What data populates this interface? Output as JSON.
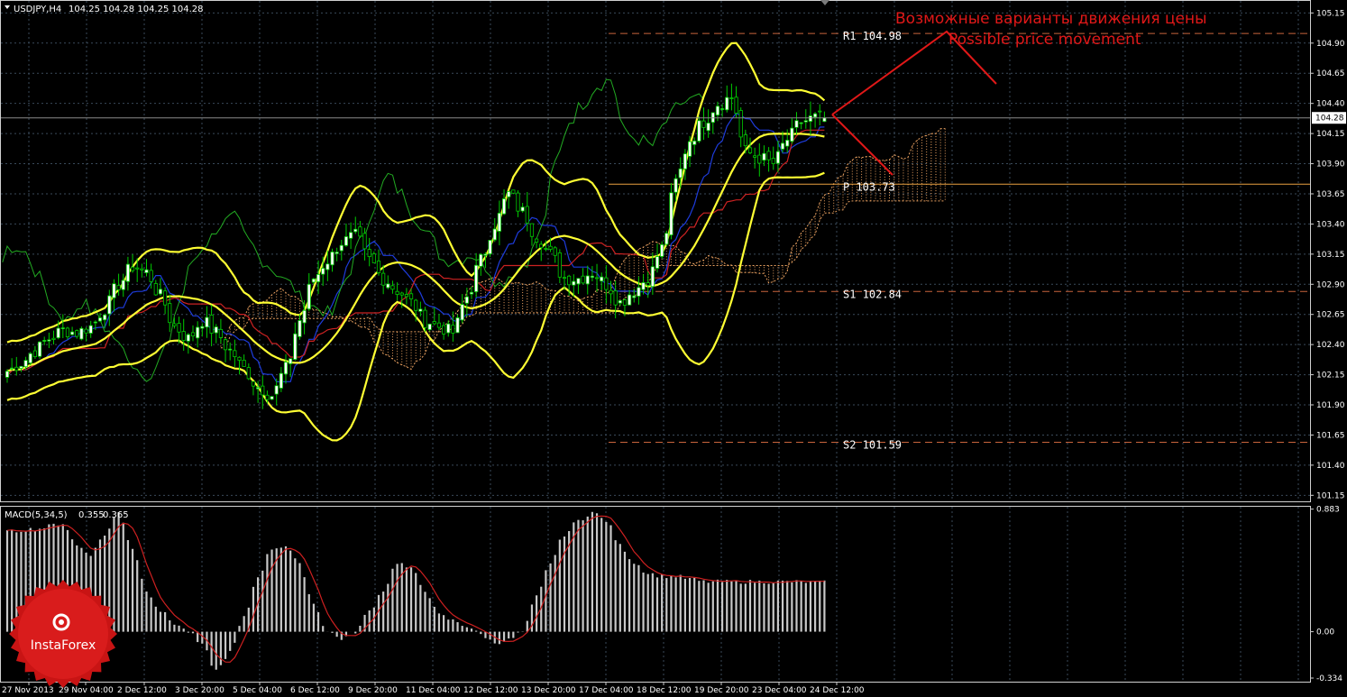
{
  "header": {
    "symbol_timeframe": "USDJPY,H4",
    "ohlc": "104.25 104.28 104.25 104.28"
  },
  "annotations": {
    "ru": "Возможные варианты движения цены",
    "en": "Possible price movement"
  },
  "pivot_levels": [
    {
      "label": "R1",
      "value": 104.98,
      "color": "#c8643c",
      "style": "dashed"
    },
    {
      "label": "P",
      "value": 103.73,
      "color": "#e8a040",
      "style": "solid"
    },
    {
      "label": "S1",
      "value": 102.84,
      "color": "#c8643c",
      "style": "dashed"
    },
    {
      "label": "S2",
      "value": 101.59,
      "color": "#c8643c",
      "style": "dashed"
    }
  ],
  "logo": {
    "text": "InstaForex"
  },
  "chart_data": {
    "type": "candlestick",
    "price_axis_ticks": [
      "105.15",
      "104.90",
      "104.65",
      "104.40",
      "104.15",
      "103.90",
      "103.65",
      "103.40",
      "103.15",
      "102.90",
      "102.65",
      "102.40",
      "102.15",
      "101.90",
      "101.65",
      "101.40",
      "101.15"
    ],
    "price_ylim": [
      101.1,
      105.25
    ],
    "current_price": "104.28",
    "x_tick_labels": [
      "27 Nov 2013",
      "29 Nov 04:00",
      "2 Dec 12:00",
      "3 Dec 20:00",
      "5 Dec 04:00",
      "6 Dec 12:00",
      "9 Dec 20:00",
      "11 Dec 04:00",
      "12 Dec 12:00",
      "13 Dec 20:00",
      "17 Dec 04:00",
      "18 Dec 12:00",
      "19 Dec 20:00",
      "23 Dec 04:00",
      "24 Dec 12:00"
    ],
    "macd": {
      "label": "MACD(5,34,5)",
      "main": "0.355",
      "signal": "0.365",
      "axis_ticks": [
        "0.883",
        "0.00",
        "-0.334"
      ],
      "ylim": [
        -0.36,
        0.9
      ]
    },
    "candle_key_points": [
      [
        0,
        102.18
      ],
      [
        3,
        102.25
      ],
      [
        6,
        102.35
      ],
      [
        9,
        102.45
      ],
      [
        12,
        102.52
      ],
      [
        15,
        102.5
      ],
      [
        18,
        102.55
      ],
      [
        21,
        102.7
      ],
      [
        24,
        102.9
      ],
      [
        27,
        103.05
      ],
      [
        30,
        103.0
      ],
      [
        33,
        102.8
      ],
      [
        36,
        102.55
      ],
      [
        39,
        102.45
      ],
      [
        42,
        102.6
      ],
      [
        45,
        102.5
      ],
      [
        48,
        102.35
      ],
      [
        51,
        102.2
      ],
      [
        54,
        102.05
      ],
      [
        57,
        101.98
      ],
      [
        60,
        102.2
      ],
      [
        63,
        102.6
      ],
      [
        66,
        102.95
      ],
      [
        69,
        103.1
      ],
      [
        72,
        103.25
      ],
      [
        75,
        103.3
      ],
      [
        78,
        103.1
      ],
      [
        81,
        102.95
      ],
      [
        84,
        102.85
      ],
      [
        87,
        102.75
      ],
      [
        90,
        102.6
      ],
      [
        93,
        102.55
      ],
      [
        96,
        102.5
      ],
      [
        99,
        102.8
      ],
      [
        102,
        103.1
      ],
      [
        105,
        103.4
      ],
      [
        108,
        103.65
      ],
      [
        111,
        103.5
      ],
      [
        114,
        103.3
      ],
      [
        117,
        103.15
      ],
      [
        120,
        102.95
      ],
      [
        123,
        102.95
      ],
      [
        126,
        103.0
      ],
      [
        129,
        102.9
      ],
      [
        132,
        102.75
      ],
      [
        135,
        102.85
      ],
      [
        138,
        102.95
      ],
      [
        141,
        103.2
      ],
      [
        144,
        103.75
      ],
      [
        147,
        104.1
      ],
      [
        150,
        104.25
      ],
      [
        153,
        104.4
      ],
      [
        156,
        104.45
      ],
      [
        159,
        104.0
      ],
      [
        162,
        103.95
      ],
      [
        165,
        103.9
      ],
      [
        168,
        104.1
      ],
      [
        171,
        104.25
      ],
      [
        174,
        104.28
      ],
      [
        176,
        104.28
      ]
    ],
    "macd_key_points": [
      [
        0,
        0.72
      ],
      [
        6,
        0.74
      ],
      [
        12,
        0.78
      ],
      [
        15,
        0.62
      ],
      [
        18,
        0.56
      ],
      [
        21,
        0.7
      ],
      [
        24,
        0.86
      ],
      [
        27,
        0.6
      ],
      [
        30,
        0.3
      ],
      [
        33,
        0.15
      ],
      [
        36,
        0.06
      ],
      [
        39,
        0.0
      ],
      [
        42,
        -0.1
      ],
      [
        45,
        -0.28
      ],
      [
        48,
        -0.15
      ],
      [
        51,
        0.1
      ],
      [
        54,
        0.4
      ],
      [
        57,
        0.6
      ],
      [
        60,
        0.62
      ],
      [
        63,
        0.48
      ],
      [
        66,
        0.2
      ],
      [
        69,
        0.0
      ],
      [
        72,
        -0.05
      ],
      [
        75,
        0.0
      ],
      [
        78,
        0.15
      ],
      [
        81,
        0.3
      ],
      [
        84,
        0.5
      ],
      [
        87,
        0.45
      ],
      [
        90,
        0.3
      ],
      [
        93,
        0.12
      ],
      [
        96,
        0.08
      ],
      [
        99,
        0.04
      ],
      [
        102,
        -0.02
      ],
      [
        105,
        -0.08
      ],
      [
        108,
        -0.06
      ],
      [
        111,
        0.0
      ],
      [
        114,
        0.25
      ],
      [
        117,
        0.5
      ],
      [
        120,
        0.7
      ],
      [
        123,
        0.8
      ],
      [
        126,
        0.86
      ],
      [
        129,
        0.8
      ],
      [
        132,
        0.62
      ],
      [
        135,
        0.5
      ],
      [
        138,
        0.42
      ],
      [
        141,
        0.4
      ],
      [
        144,
        0.4
      ],
      [
        147,
        0.38
      ],
      [
        150,
        0.36
      ],
      [
        153,
        0.36
      ],
      [
        156,
        0.36
      ],
      [
        159,
        0.36
      ],
      [
        162,
        0.36
      ],
      [
        165,
        0.36
      ],
      [
        168,
        0.36
      ],
      [
        171,
        0.36
      ],
      [
        174,
        0.355
      ],
      [
        176,
        0.355
      ]
    ],
    "indicator_colors": {
      "bull_candle": "#ffffff",
      "bear_candle": "#000000",
      "candle_wick": "#00cc00",
      "bollinger": "#ffff33",
      "kijun": "#cc2222",
      "tenkan": "#1e3cdc",
      "chikou": "#22aa22",
      "cloud": "#e8a060",
      "macd_hist": "#c8c8c8",
      "macd_signal": "#cc2020",
      "grid": "#3a4a5a",
      "arrow": "#e01818",
      "logo": "#c81414"
    }
  }
}
